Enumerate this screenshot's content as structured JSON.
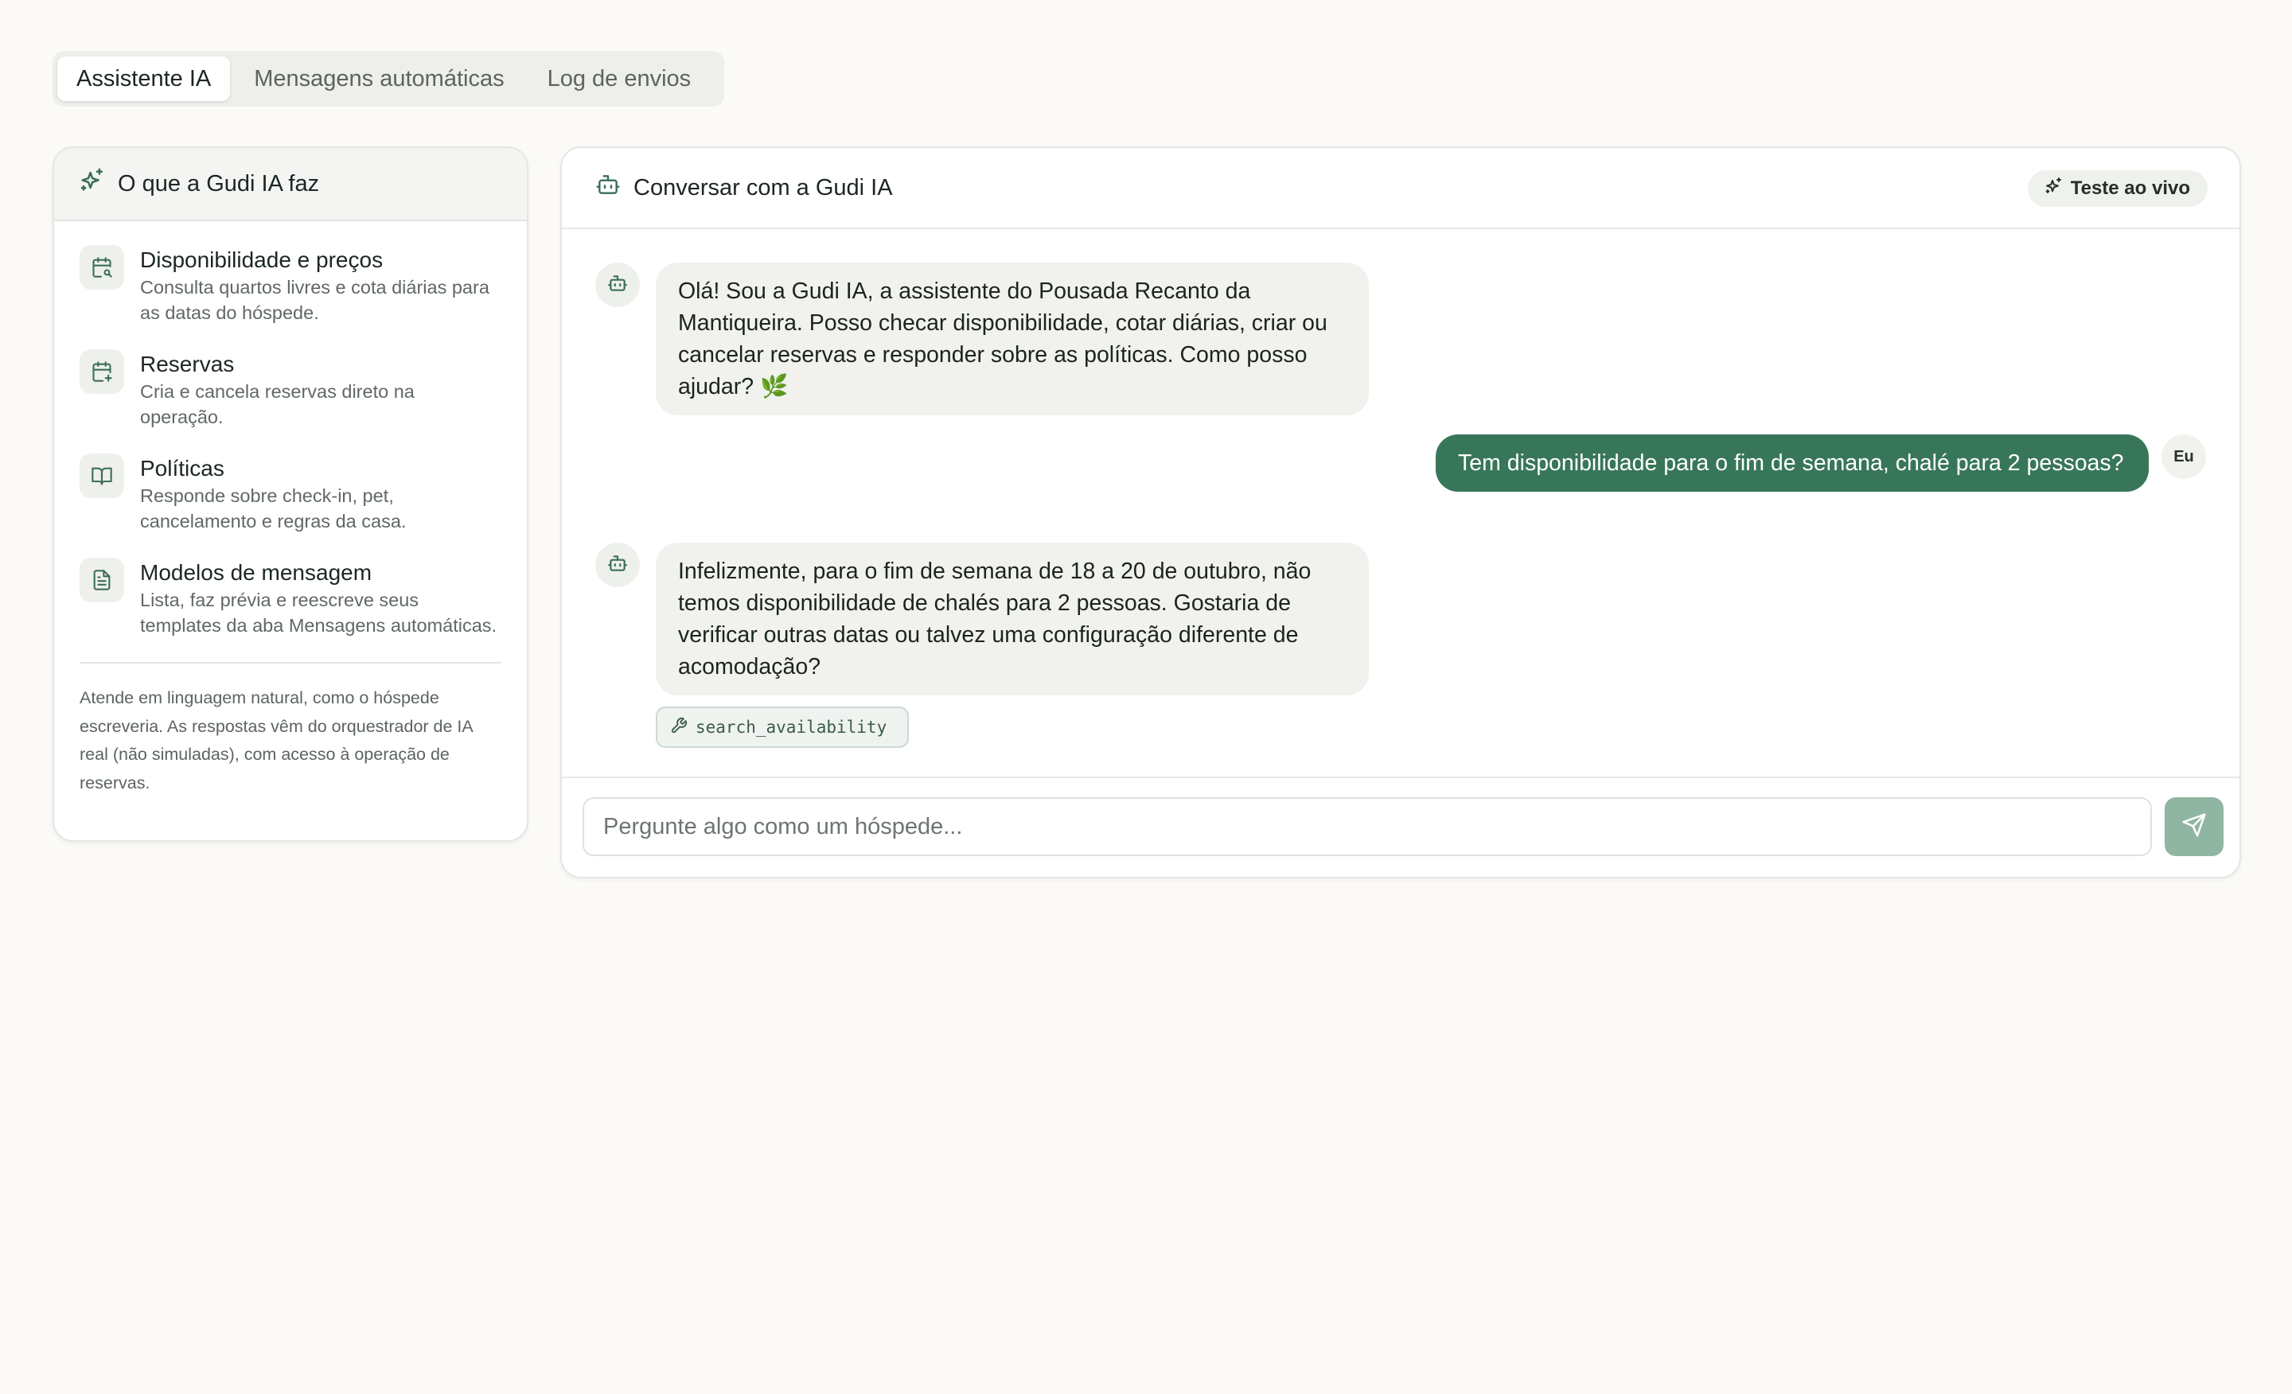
{
  "tabs": [
    {
      "label": "Assistente IA",
      "active": true
    },
    {
      "label": "Mensagens automáticas",
      "active": false
    },
    {
      "label": "Log de envios",
      "active": false
    }
  ],
  "features": {
    "title": "O que a Gudi IA faz",
    "title_icon": "sparkles-icon",
    "items": [
      {
        "icon": "calendar-search-icon",
        "title": "Disponibilidade e preços",
        "desc": "Consulta quartos livres e cota diárias para as datas do hóspede."
      },
      {
        "icon": "calendar-plus-icon",
        "title": "Reservas",
        "desc": "Cria e cancela reservas direto na operação."
      },
      {
        "icon": "book-open-icon",
        "title": "Políticas",
        "desc": "Responde sobre check-in, pet, cancelamento e regras da casa."
      },
      {
        "icon": "file-text-icon",
        "title": "Modelos de mensagem",
        "desc": "Lista, faz prévia e reescreve seus templates da aba Mensagens automáticas."
      }
    ],
    "note": "Atende em linguagem natural, como o hóspede escreveria. As respostas vêm do orquestrador de IA real (não simuladas), com acesso à operação de reservas."
  },
  "chat": {
    "title": "Conversar com a Gudi IA",
    "title_icon": "bot-icon",
    "badge": "Teste ao vivo",
    "badge_icon": "sparkles-icon",
    "messages": [
      {
        "role": "assistant",
        "text": "Olá! Sou a Gudi IA, a assistente do Pousada Recanto da Mantiqueira. Posso checar disponibilidade, cotar diárias, criar ou cancelar reservas e responder sobre as políticas. Como posso ajudar? 🌿"
      },
      {
        "role": "user",
        "avatar_label": "Eu",
        "text": "Tem disponibilidade para o fim de semana, chalé para 2 pessoas?"
      },
      {
        "role": "assistant",
        "text": "Infelizmente, para o fim de semana de 18 a 20 de outubro, não temos disponibilidade de chalés para 2 pessoas. Gostaria de verificar outras datas ou talvez uma configuração diferente de acomodação?",
        "tool": "search_availability"
      }
    ],
    "input_placeholder": "Pergunte algo como um hóspede...",
    "input_value": "",
    "send_icon": "send-icon"
  },
  "colors": {
    "accent": "#38765a",
    "send_button": "#8fb6a2",
    "icon": "#3b6e56",
    "background": "#fbfaf8"
  }
}
